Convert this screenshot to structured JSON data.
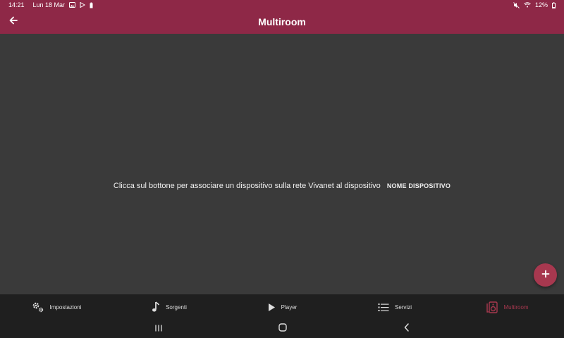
{
  "status_bar": {
    "time": "14:21",
    "date": "Lun 18 Mar",
    "battery": "12%",
    "icons": [
      "gallery-icon",
      "play-store-icon",
      "battery-saver-icon",
      "mute-icon",
      "wifi-icon",
      "battery-icon"
    ]
  },
  "app_bar": {
    "title": "Multiroom",
    "back_icon": "arrow-left-icon"
  },
  "content": {
    "message": "Clicca sul bottone per associare un dispositivo sulla rete Vivanet al dispositivo",
    "device_name": "NOME DISPOSITIVO"
  },
  "fab": {
    "label": "+",
    "icon": "plus-icon"
  },
  "bottom_nav": {
    "items": [
      {
        "label": "Impostazioni",
        "icon": "gears-icon",
        "active": false
      },
      {
        "label": "Sorgenti",
        "icon": "music-note-icon",
        "active": false
      },
      {
        "label": "Player",
        "icon": "play-icon",
        "active": false
      },
      {
        "label": "Servizi",
        "icon": "list-icon",
        "active": false
      },
      {
        "label": "Multiroom",
        "icon": "speaker-icon",
        "active": true
      }
    ]
  },
  "system_nav": {
    "icons": [
      "recent-apps-icon",
      "home-icon",
      "back-icon"
    ]
  },
  "colors": {
    "primary": "#8e2847",
    "accent": "#a7384f",
    "background": "#3a3a3a",
    "nav_background": "#1f1f1f"
  }
}
